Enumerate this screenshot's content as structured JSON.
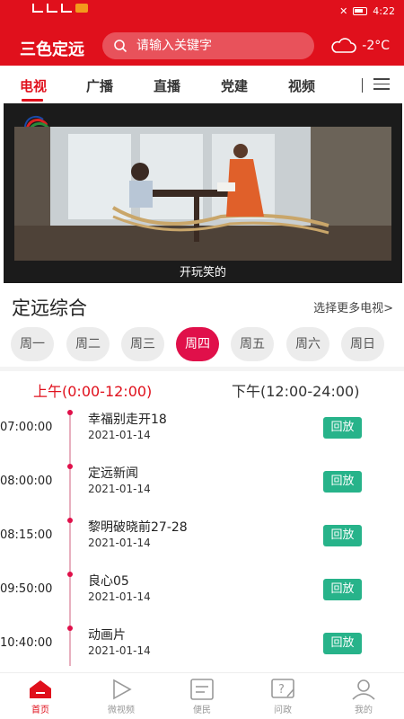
{
  "status_bar": {
    "time": "4:22"
  },
  "header": {
    "logo": "三色定远",
    "search_placeholder": "请输入关键字",
    "temperature": "-2°C"
  },
  "tabs": [
    {
      "label": "电视",
      "active": true
    },
    {
      "label": "广播"
    },
    {
      "label": "直播"
    },
    {
      "label": "党建"
    },
    {
      "label": "视频"
    }
  ],
  "video": {
    "subtitle": "开玩笑的"
  },
  "channel": {
    "title": "定远综合",
    "more": "选择更多电视>"
  },
  "days": [
    {
      "label": "周一"
    },
    {
      "label": "周二"
    },
    {
      "label": "周三"
    },
    {
      "label": "周四",
      "active": true
    },
    {
      "label": "周五"
    },
    {
      "label": "周六"
    },
    {
      "label": "周日"
    }
  ],
  "schedule": {
    "am_label": "上午(0:00-12:00)",
    "pm_label": "下午(12:00-24:00)",
    "programs": [
      {
        "time": "07:00:00",
        "name": "幸福别走开18",
        "date": "2021-01-14",
        "action": "回放"
      },
      {
        "time": "08:00:00",
        "name": "定远新闻",
        "date": "2021-01-14",
        "action": "回放"
      },
      {
        "time": "08:15:00",
        "name": "黎明破晓前27-28",
        "date": "2021-01-14",
        "action": "回放"
      },
      {
        "time": "09:50:00",
        "name": "良心05",
        "date": "2021-01-14",
        "action": "回放"
      },
      {
        "time": "10:40:00",
        "name": "动画片",
        "date": "2021-01-14",
        "action": "回放"
      }
    ]
  },
  "bottom_nav": [
    {
      "label": "首页",
      "icon": "home-icon",
      "active": true
    },
    {
      "label": "微视频",
      "icon": "play-icon"
    },
    {
      "label": "便民",
      "icon": "service-icon"
    },
    {
      "label": "问政",
      "icon": "question-icon"
    },
    {
      "label": "我的",
      "icon": "user-icon"
    }
  ],
  "colors": {
    "brand_red": "#e0101c",
    "accent_pink": "#e0104a",
    "replay_green": "#27b38a"
  }
}
